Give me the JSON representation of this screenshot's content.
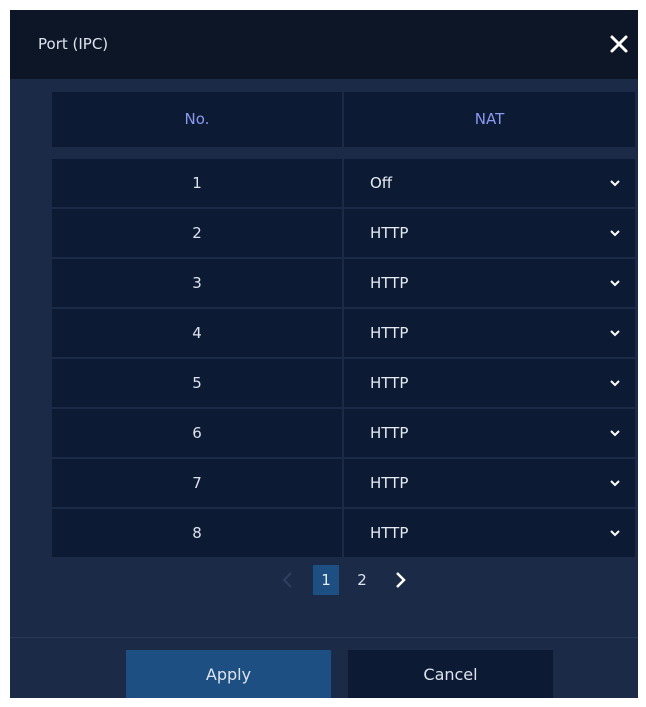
{
  "dialog": {
    "title": "Port (IPC)",
    "close_icon": "close-icon"
  },
  "table": {
    "headers": {
      "no": "No.",
      "nat": "NAT"
    },
    "rows": [
      {
        "no": "1",
        "nat": "Off"
      },
      {
        "no": "2",
        "nat": "HTTP"
      },
      {
        "no": "3",
        "nat": "HTTP"
      },
      {
        "no": "4",
        "nat": "HTTP"
      },
      {
        "no": "5",
        "nat": "HTTP"
      },
      {
        "no": "6",
        "nat": "HTTP"
      },
      {
        "no": "7",
        "nat": "HTTP"
      },
      {
        "no": "8",
        "nat": "HTTP"
      }
    ]
  },
  "pagination": {
    "pages": [
      "1",
      "2"
    ],
    "current": "1"
  },
  "footer": {
    "apply_label": "Apply",
    "cancel_label": "Cancel"
  },
  "colors": {
    "dialog_bg": "#1b2b47",
    "titlebar_bg": "#0d1626",
    "cell_bg": "#0d1a33",
    "header_text": "#8a98f0",
    "accent": "#1d4f82"
  }
}
